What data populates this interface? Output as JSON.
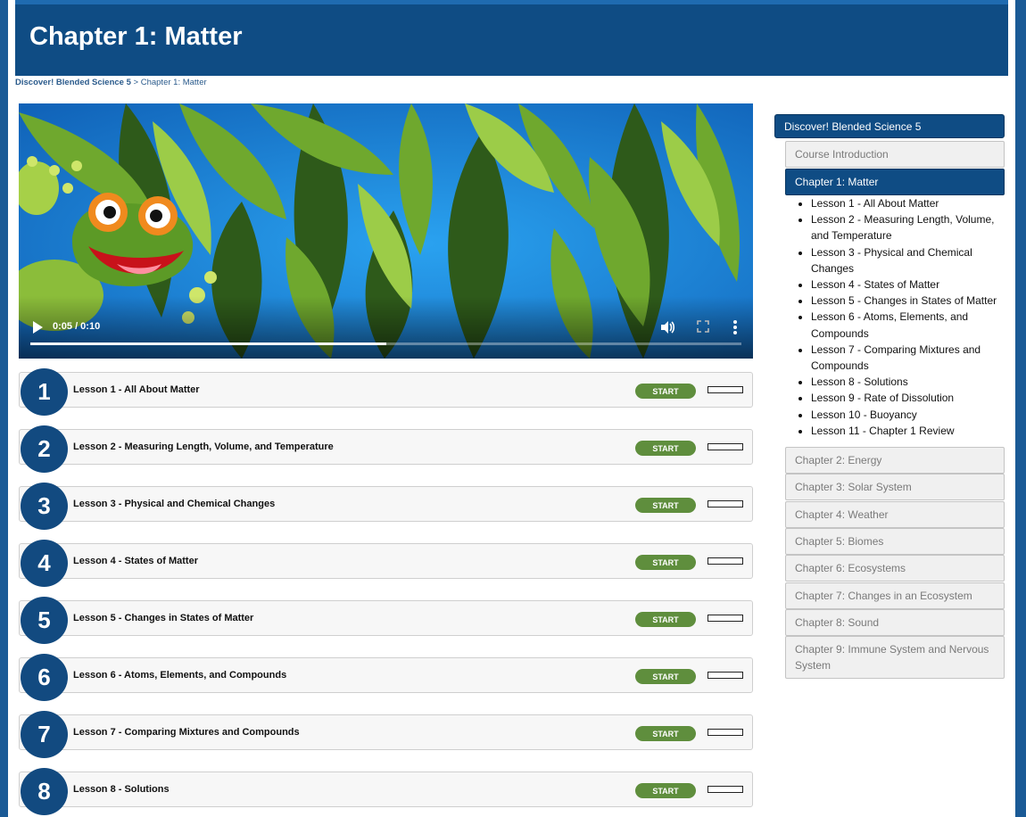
{
  "header": {
    "title": "Chapter 1: Matter"
  },
  "breadcrumb": {
    "course": "Discover! Blended Science 5",
    "separator": " > ",
    "current": "Chapter 1: Matter"
  },
  "video": {
    "time": "0:05 / 0:10",
    "progress": 0.5
  },
  "lessons": [
    {
      "num": "1",
      "title": "Lesson 1 - All About Matter",
      "button": "START"
    },
    {
      "num": "2",
      "title": "Lesson 2 - Measuring Length, Volume, and Temperature",
      "button": "START"
    },
    {
      "num": "3",
      "title": "Lesson 3 - Physical and Chemical Changes",
      "button": "START"
    },
    {
      "num": "4",
      "title": "Lesson 4 - States of Matter",
      "button": "START"
    },
    {
      "num": "5",
      "title": "Lesson 5 - Changes in States of Matter",
      "button": "START"
    },
    {
      "num": "6",
      "title": "Lesson 6 - Atoms, Elements, and Compounds",
      "button": "START"
    },
    {
      "num": "7",
      "title": "Lesson 7 - Comparing Mixtures and Compounds",
      "button": "START"
    },
    {
      "num": "8",
      "title": "Lesson 8 - Solutions",
      "button": "START"
    }
  ],
  "sidebar": {
    "course": "Discover! Blended Science 5",
    "intro": "Course Introduction",
    "current_chapter": "Chapter 1: Matter",
    "chapter_lessons": [
      "Lesson 1 - All About Matter",
      "Lesson 2 - Measuring Length, Volume, and Temperature",
      "Lesson 3 - Physical and Chemical Changes",
      "Lesson 4 - States of Matter",
      "Lesson 5 - Changes in States of Matter",
      "Lesson 6 - Atoms, Elements, and Compounds",
      "Lesson 7 - Comparing Mixtures and Compounds",
      "Lesson 8 - Solutions",
      "Lesson 9 - Rate of Dissolution",
      "Lesson 10 - Buoyancy",
      "Lesson 11 - Chapter 1 Review"
    ],
    "chapters": [
      "Chapter 2: Energy",
      "Chapter 3: Solar System",
      "Chapter 4: Weather",
      "Chapter 5: Biomes",
      "Chapter 6: Ecosystems",
      "Chapter 7: Changes in an Ecosystem",
      "Chapter 8: Sound",
      "Chapter 9: Immune System and Nervous System"
    ]
  },
  "colors": {
    "brand": "#0f4c84",
    "start_button": "#5f8e3d"
  },
  "icons": {
    "play": "play-icon",
    "volume": "volume-icon",
    "fullscreen": "fullscreen-icon",
    "menu": "more-vertical-icon"
  }
}
